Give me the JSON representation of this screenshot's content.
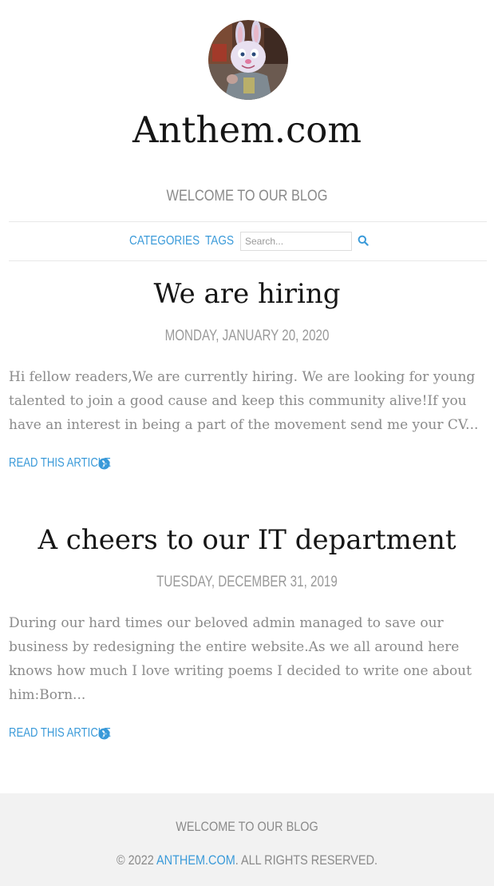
{
  "header": {
    "site_title": "Anthem.com",
    "tagline": "Welcome to our blog"
  },
  "nav": {
    "categories_label": "Categories",
    "tags_label": "Tags",
    "search_placeholder": "Search...",
    "search_value": ""
  },
  "posts": [
    {
      "title": "We are hiring",
      "date": "Monday, January 20, 2020",
      "excerpt": "Hi fellow readers,We are currently hiring. We are looking for young talented to join a good cause and keep this community alive!If you have an interest in being a part of the movement send me your CV...",
      "read_more": "Read this article"
    },
    {
      "title": "A cheers to our IT department",
      "date": "Tuesday, December 31, 2019",
      "excerpt": "During our hard times our beloved admin managed to save our business by redesigning the entire website.As we all around here knows how much I love writing poems I decided to write one about him:Born...",
      "read_more": "Read this article"
    }
  ],
  "footer": {
    "tagline": "Welcome to our blog",
    "copyright_prefix": "© 2022 ",
    "copyright_link": "Anthem.com",
    "copyright_suffix": ". All rights reserved."
  },
  "colors": {
    "accent": "#3a9ad9",
    "muted_text": "#8a8a8a",
    "title_text": "#161616",
    "footer_bg": "#f2f2f2"
  },
  "icons": {
    "search": "search-icon",
    "read_more": "chevron-circle-right-icon",
    "avatar": "bunny-avatar"
  }
}
